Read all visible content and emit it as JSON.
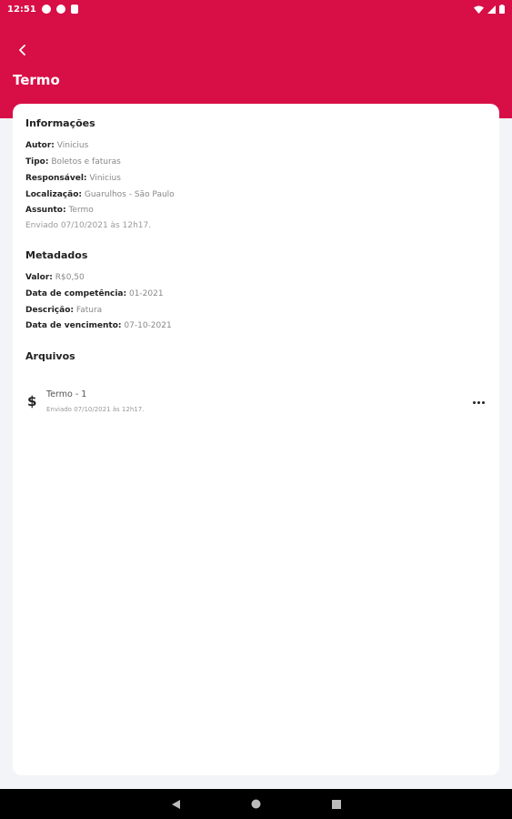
{
  "status_bar": {
    "time": "12:51",
    "icons": [
      "app-a-icon",
      "app-g-icon",
      "app-square-icon",
      "wifi-icon",
      "signal-icon",
      "battery-icon"
    ]
  },
  "header": {
    "title": "Termo",
    "back_icon": "chevron-left-icon",
    "color": "#d80e46"
  },
  "informacoes": {
    "title": "Informações",
    "autor_label": "Autor:",
    "autor_value": "Vinicius",
    "tipo_label": "Tipo:",
    "tipo_value": "Boletos e faturas",
    "responsavel_label": "Responsável:",
    "responsavel_value": "Vinicius",
    "localizacao_label": "Localização:",
    "localizacao_value": "Guarulhos - São Paulo",
    "assunto_label": "Assunto:",
    "assunto_value": "Termo",
    "enviado": "Enviado 07/10/2021 às 12h17."
  },
  "metadados": {
    "title": "Metadados",
    "valor_label": "Valor:",
    "valor_value": "R$0,50",
    "competencia_label": "Data de competência:",
    "competencia_value": "01-2021",
    "descricao_label": "Descrição:",
    "descricao_value": "Fatura",
    "vencimento_label": "Data de vencimento:",
    "vencimento_value": "07-10-2021"
  },
  "arquivos": {
    "title": "Arquivos",
    "items": [
      {
        "icon": "dollar-icon",
        "name": "Termo - 1",
        "sent": "Enviado 07/10/2021 às 12h17."
      }
    ]
  },
  "nav": {
    "icons": [
      "back-triangle-icon",
      "home-circle-icon",
      "recents-square-icon"
    ]
  }
}
